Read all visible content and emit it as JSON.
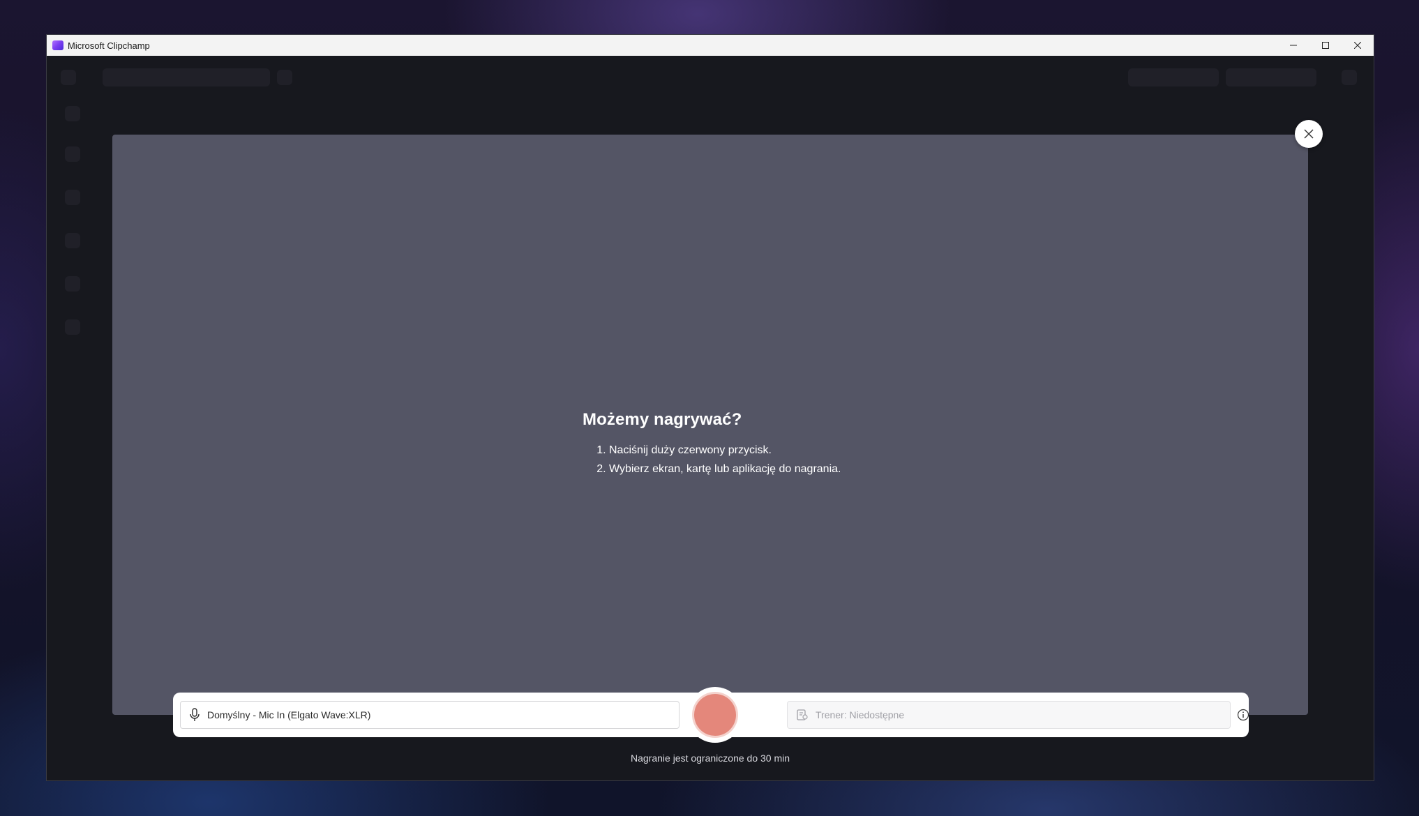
{
  "window": {
    "title": "Microsoft Clipchamp",
    "controls": {
      "minimize": "minimize-icon",
      "maximize": "maximize-icon",
      "close": "close-icon"
    }
  },
  "recorder": {
    "heading": "Możemy nagrywać?",
    "steps": [
      "Naciśnij duży czerwony przycisk.",
      "Wybierz ekran, kartę lub aplikację do nagrania."
    ],
    "microphone": {
      "icon": "microphone-icon",
      "value": "Domyślny - Mic In (Elgato Wave:XLR)"
    },
    "coach": {
      "icon": "coach-icon",
      "value": "Trener: Niedostępne"
    },
    "record_button_color": "#e4877b",
    "limit_note": "Nagranie jest ograniczone do 30 min"
  },
  "colors": {
    "preview_background": "#545565",
    "window_background": "#1e1f26"
  }
}
